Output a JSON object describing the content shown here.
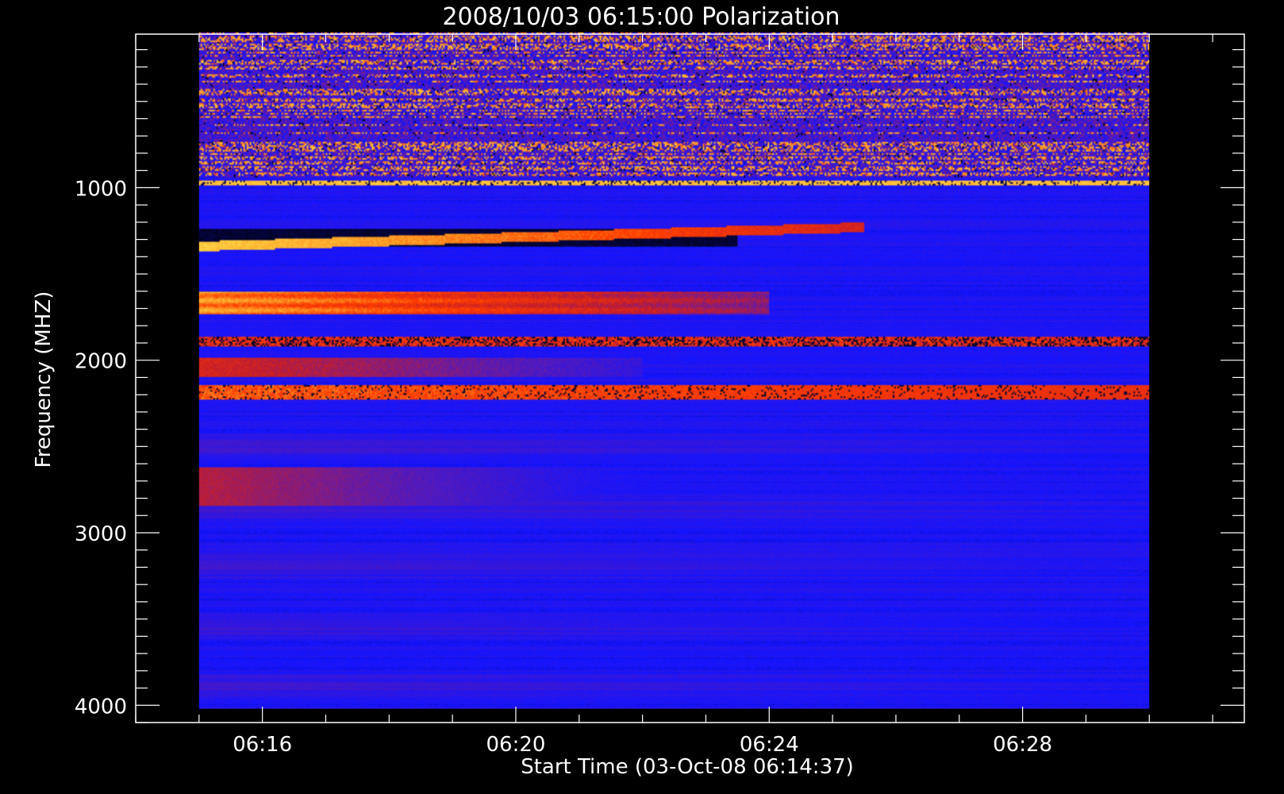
{
  "chart_data": {
    "type": "heatmap",
    "title": "2008/10/03 06:15:00 Polarization",
    "xlabel": "Start Time (03-Oct-08 06:14:37)",
    "ylabel": "Frequency (MHZ)",
    "x_axis": {
      "unit": "time",
      "range": [
        "06:14:00",
        "06:31:30"
      ],
      "data_extent": [
        "06:15:00",
        "06:30:00"
      ],
      "ticks": [
        {
          "value": "06:16",
          "label": "06:16"
        },
        {
          "value": "06:20",
          "label": "06:20"
        },
        {
          "value": "06:24",
          "label": "06:24"
        },
        {
          "value": "06:28",
          "label": "06:28"
        }
      ],
      "minor_step_seconds": 60
    },
    "y_axis": {
      "unit": "MHz",
      "range": [
        110,
        4100
      ],
      "data_extent": [
        100,
        4020
      ],
      "inverted": true,
      "ticks": [
        {
          "value": 1000,
          "label": "1000"
        },
        {
          "value": 2000,
          "label": "2000"
        },
        {
          "value": 3000,
          "label": "3000"
        },
        {
          "value": 4000,
          "label": "4000"
        }
      ],
      "minor_step": 100
    },
    "grid": false,
    "colorscale": [
      "#000000",
      "#1414ff",
      "#5a1ab4",
      "#c81e28",
      "#ff3c00",
      "#ffa028",
      "#ffe650"
    ],
    "features": [
      {
        "name": "noisy-upper-band",
        "f_range": [
          100,
          940
        ],
        "t_range": [
          "06:15:00",
          "06:30:00"
        ],
        "level": 0.4
      },
      {
        "name": "yellow-stripe",
        "f_range": [
          955,
          985
        ],
        "t_range": [
          "06:15:00",
          "06:30:00"
        ],
        "level": 0.85
      },
      {
        "name": "dark-gap",
        "f_range": [
          1240,
          1340
        ],
        "t_range": [
          "06:15:00",
          "06:23:30"
        ],
        "level": 0.0
      },
      {
        "name": "drifting-burst",
        "f_range": [
          1200,
          1390
        ],
        "t_range": [
          "06:15:00",
          "06:25:30"
        ],
        "level": 0.9
      },
      {
        "name": "red-band",
        "f_range": [
          1600,
          1730
        ],
        "t_range": [
          "06:15:00",
          "06:24:00"
        ],
        "level": 0.75
      },
      {
        "name": "spiky-band",
        "f_range": [
          1860,
          1920
        ],
        "t_range": [
          "06:15:00",
          "06:30:00"
        ],
        "level": 0.6
      },
      {
        "name": "faint-band",
        "f_range": [
          1990,
          2100
        ],
        "t_range": [
          "06:15:00",
          "06:22:00"
        ],
        "level": 0.5
      },
      {
        "name": "bright-band",
        "f_range": [
          2140,
          2230
        ],
        "t_range": [
          "06:15:00",
          "06:30:00"
        ],
        "level": 0.8
      },
      {
        "name": "faint-red-band",
        "f_range": [
          2620,
          2840
        ],
        "t_range": [
          "06:15:00",
          "06:23:00"
        ],
        "level": 0.45
      },
      {
        "name": "background",
        "f_range": [
          2300,
          4020
        ],
        "t_range": [
          "06:15:00",
          "06:30:00"
        ],
        "level": 0.15
      }
    ]
  },
  "colors": {
    "background": "#000000",
    "axis": "#ffffff",
    "text": "#ffffff"
  }
}
